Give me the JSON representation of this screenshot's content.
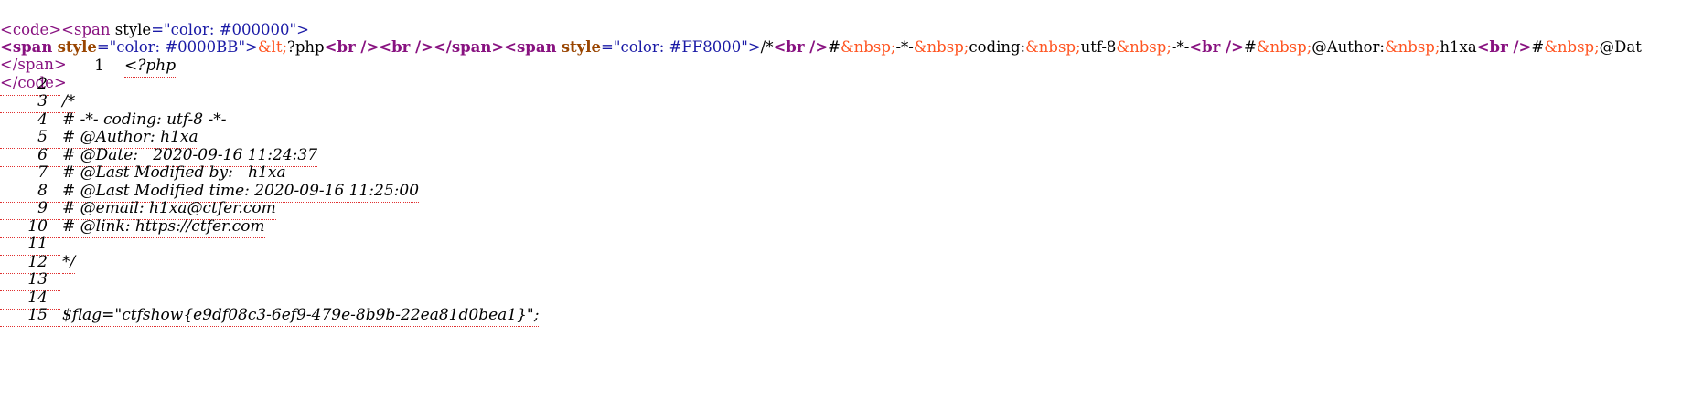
{
  "source_view": {
    "line1": {
      "open_code": "<code>",
      "open_span": "<span",
      "attr_name": "style",
      "attr_eq": "=\"",
      "attr_value": "color: #000000",
      "attr_close": "\">"
    },
    "line2": {
      "span1_open": "<span",
      "span1_attr": "style",
      "span1_eq": "=\"",
      "span1_value": "color: #0000BB",
      "span1_close": "\">",
      "lt_entity": "&lt;",
      "php_text": "?php",
      "br1_tag": "<br",
      "br1_end": " />",
      "br2_tag": "<br",
      "br2_end": " />",
      "span_close": "</span>",
      "span2_open": "<span",
      "span2_attr": "style",
      "span2_eq": "=\"",
      "span2_value": "color: #FF8000",
      "span2_close": "\">",
      "text1": "/*",
      "br3_tag": "<br",
      "br3_end": " />",
      "hash1": "#",
      "nbsp1": "&nbsp;",
      "t1": "-*-",
      "nbsp2": "&nbsp;",
      "t2": "coding:",
      "nbsp3": "&nbsp;",
      "t3": "utf-8",
      "nbsp4": "&nbsp;",
      "t4": "-*-",
      "br4_tag": "<br",
      "br4_end": " />",
      "hash2": "#",
      "nbsp5": "&nbsp;",
      "t5": "@Author:",
      "nbsp6": "&nbsp;",
      "t6": "h1xa",
      "br5_tag": "<br",
      "br5_end": " />",
      "hash3": "#",
      "nbsp7": "&nbsp;",
      "t7": "@Dat"
    },
    "line3": {
      "close_span": "</span>"
    },
    "line4": {
      "close_code": "</code>"
    }
  },
  "code_lines": [
    {
      "num": "1",
      "text": "<?php"
    },
    {
      "num": "2",
      "text": ""
    },
    {
      "num": "3",
      "text": "/*"
    },
    {
      "num": "4",
      "text": "# -*- coding: utf-8 -*-"
    },
    {
      "num": "5",
      "text": "# @Author: h1xa"
    },
    {
      "num": "6",
      "text": "# @Date:   2020-09-16 11:24:37"
    },
    {
      "num": "7",
      "text": "# @Last Modified by:   h1xa"
    },
    {
      "num": "8",
      "text": "# @Last Modified time: 2020-09-16 11:25:00"
    },
    {
      "num": "9",
      "text": "# @email: h1xa@ctfer.com"
    },
    {
      "num": "10",
      "text": "# @link: https://ctfer.com"
    },
    {
      "num": "11",
      "text": ""
    },
    {
      "num": "12",
      "text": "*/"
    },
    {
      "num": "13",
      "text": ""
    },
    {
      "num": "14",
      "text": ""
    },
    {
      "num": "15",
      "text": "$flag=\"ctfshow{e9df08c3-6ef9-479e-8b9b-22ea81d0bea1}\";"
    }
  ],
  "colors": {
    "tag": "#881280",
    "attr": "#994500",
    "string": "#1a1aa6",
    "entity": "#ff5522",
    "underline": "#e03030"
  }
}
